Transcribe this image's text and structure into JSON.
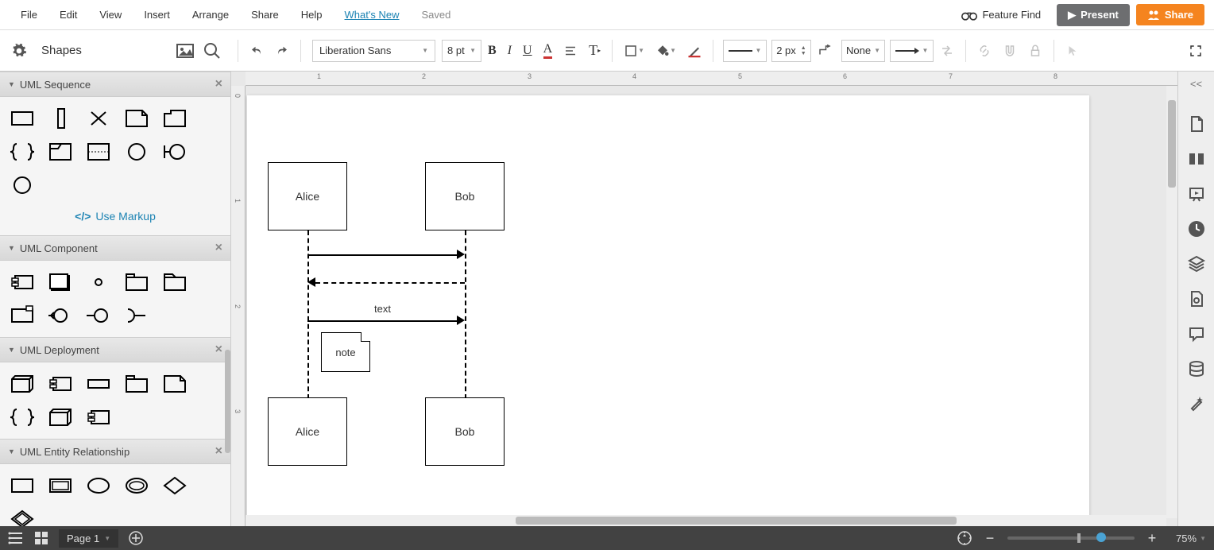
{
  "menu": {
    "file": "File",
    "edit": "Edit",
    "view": "View",
    "insert": "Insert",
    "arrange": "Arrange",
    "share": "Share",
    "help": "Help",
    "whats_new": "What's New",
    "saved": "Saved",
    "feature_find": "Feature Find",
    "present": "Present",
    "share_btn": "Share"
  },
  "toolbar": {
    "shapes": "Shapes",
    "font": "Liberation Sans",
    "font_size": "8 pt",
    "line_width": "2 px",
    "line_end": "None"
  },
  "panels": {
    "sequence": "UML Sequence",
    "use_markup": "Use Markup",
    "component": "UML Component",
    "deployment": "UML Deployment",
    "entity": "UML Entity Relationship"
  },
  "diagram": {
    "alice": "Alice",
    "bob": "Bob",
    "text": "text",
    "note": "note"
  },
  "bottom": {
    "page": "Page 1",
    "zoom": "75%"
  },
  "ruler_h": [
    "1",
    "2",
    "3",
    "4",
    "5",
    "6",
    "7",
    "8"
  ],
  "ruler_v": [
    "0",
    "1",
    "2",
    "3"
  ],
  "chart_data": {
    "type": "uml-sequence",
    "participants": [
      "Alice",
      "Bob"
    ],
    "messages": [
      {
        "from": "Alice",
        "to": "Bob",
        "label": "",
        "style": "solid"
      },
      {
        "from": "Bob",
        "to": "Alice",
        "label": "",
        "style": "dashed"
      },
      {
        "from": "Alice",
        "to": "Bob",
        "label": "text",
        "style": "solid"
      }
    ],
    "notes": [
      {
        "over": "Alice",
        "text": "note"
      }
    ]
  }
}
